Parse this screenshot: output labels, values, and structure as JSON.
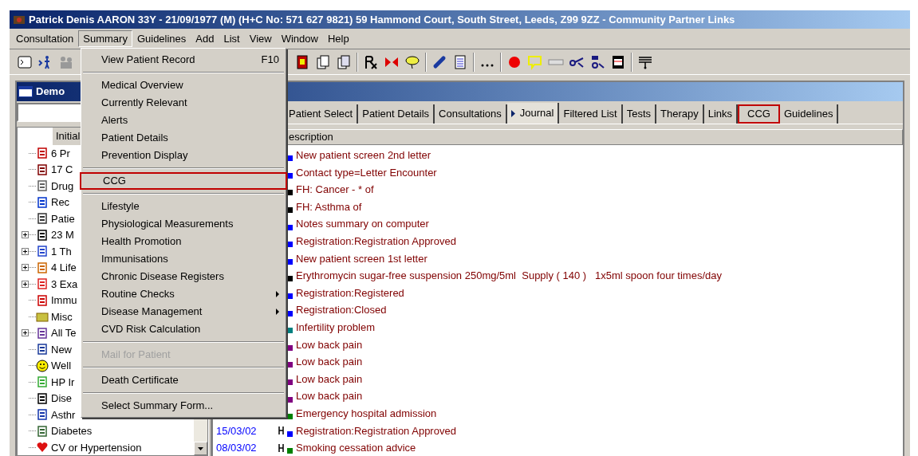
{
  "window": {
    "title": "Patrick Denis AARON 33Y - 21/09/1977 (M) (H+C No: 571 627 9821)  59 Hammond Court, South Street, Leeds, Z99 9ZZ - Community Partner Links"
  },
  "menu_bar": [
    {
      "label": "Consultation",
      "selected": false
    },
    {
      "label": "Summary",
      "selected": true
    },
    {
      "label": "Guidelines",
      "selected": false
    },
    {
      "label": "Add",
      "selected": false
    },
    {
      "label": "List",
      "selected": false
    },
    {
      "label": "View",
      "selected": false
    },
    {
      "label": "Window",
      "selected": false
    },
    {
      "label": "Help",
      "selected": false
    }
  ],
  "summary_menu": [
    {
      "kind": "item",
      "label": "View Patient Record",
      "shortcut": "F10",
      "submenu": false,
      "disabled": false,
      "highlighted": false
    },
    {
      "kind": "separator"
    },
    {
      "kind": "item",
      "label": "Medical Overview",
      "submenu": false,
      "disabled": false,
      "highlighted": false
    },
    {
      "kind": "item",
      "label": "Currently Relevant",
      "submenu": false,
      "disabled": false,
      "highlighted": false
    },
    {
      "kind": "item",
      "label": "Alerts",
      "submenu": false,
      "disabled": false,
      "highlighted": false
    },
    {
      "kind": "item",
      "label": "Patient Details",
      "submenu": false,
      "disabled": false,
      "highlighted": false
    },
    {
      "kind": "item",
      "label": "Prevention Display",
      "submenu": false,
      "disabled": false,
      "highlighted": false
    },
    {
      "kind": "separator"
    },
    {
      "kind": "item",
      "label": "CCG",
      "submenu": false,
      "disabled": false,
      "highlighted": true
    },
    {
      "kind": "separator"
    },
    {
      "kind": "item",
      "label": "Lifestyle",
      "submenu": false,
      "disabled": false,
      "highlighted": false
    },
    {
      "kind": "item",
      "label": "Physiological Measurements",
      "submenu": false,
      "disabled": false,
      "highlighted": false
    },
    {
      "kind": "item",
      "label": "Health Promotion",
      "submenu": false,
      "disabled": false,
      "highlighted": false
    },
    {
      "kind": "item",
      "label": "Immunisations",
      "submenu": false,
      "disabled": false,
      "highlighted": false
    },
    {
      "kind": "item",
      "label": "Chronic Disease Registers",
      "submenu": false,
      "disabled": false,
      "highlighted": false
    },
    {
      "kind": "item",
      "label": "Routine Checks",
      "submenu": true,
      "disabled": false,
      "highlighted": false
    },
    {
      "kind": "item",
      "label": "Disease Management",
      "submenu": true,
      "disabled": false,
      "highlighted": false
    },
    {
      "kind": "item",
      "label": "CVD Risk Calculation",
      "submenu": false,
      "disabled": false,
      "highlighted": false
    },
    {
      "kind": "separator"
    },
    {
      "kind": "item",
      "label": "Mail for Patient",
      "submenu": false,
      "disabled": true,
      "highlighted": false
    },
    {
      "kind": "separator"
    },
    {
      "kind": "item",
      "label": "Death Certificate",
      "submenu": false,
      "disabled": false,
      "highlighted": false
    },
    {
      "kind": "separator"
    },
    {
      "kind": "item",
      "label": "Select Summary Form...",
      "submenu": false,
      "disabled": false,
      "highlighted": false
    }
  ],
  "child_window": {
    "title": "Demo"
  },
  "tree": {
    "header": "Initial",
    "items": [
      {
        "label": "6 Pr",
        "kind": "leaf"
      },
      {
        "label": "17 C",
        "kind": "leaf"
      },
      {
        "label": "Drug",
        "kind": "leaf"
      },
      {
        "label": "Rec",
        "kind": "leaf"
      },
      {
        "label": "Patie",
        "kind": "leaf"
      },
      {
        "label": "23 M",
        "kind": "folder"
      },
      {
        "label": "1 Th",
        "kind": "folder"
      },
      {
        "label": "4 Life",
        "kind": "folder"
      },
      {
        "label": "3 Exa",
        "kind": "folder"
      },
      {
        "label": "Immu",
        "kind": "leaf"
      },
      {
        "label": "Misc",
        "kind": "leaf"
      },
      {
        "label": "All Te",
        "kind": "folder"
      },
      {
        "label": "New",
        "kind": "leaf"
      },
      {
        "label": "Well",
        "kind": "leaf"
      },
      {
        "label": "HP Ir",
        "kind": "leaf"
      },
      {
        "label": "Dise",
        "kind": "leaf"
      },
      {
        "label": "Asthr",
        "kind": "leaf"
      },
      {
        "label": "Diabetes",
        "kind": "leaf"
      },
      {
        "label": "CV or Hypertension",
        "kind": "leaf"
      }
    ]
  },
  "tabs": [
    {
      "label": "Patient Select",
      "selected": false,
      "highlighted": false
    },
    {
      "label": "Patient Details",
      "selected": false,
      "highlighted": false
    },
    {
      "label": "Consultations",
      "selected": false,
      "highlighted": false
    },
    {
      "label": "Journal",
      "selected": true,
      "highlighted": false
    },
    {
      "label": "Filtered List",
      "selected": false,
      "highlighted": false
    },
    {
      "label": "Tests",
      "selected": false,
      "highlighted": false
    },
    {
      "label": "Therapy",
      "selected": false,
      "highlighted": false
    },
    {
      "label": "Links",
      "selected": false,
      "highlighted": false
    },
    {
      "label": "CCG",
      "selected": false,
      "highlighted": true
    },
    {
      "label": "Guidelines",
      "selected": false,
      "highlighted": false
    }
  ],
  "journal": {
    "column_header": "escription",
    "rows": [
      {
        "description": "New patient screen 2nd letter",
        "color": "#0000ff"
      },
      {
        "description": "Contact type=Letter Encounter",
        "color": "#0000ff"
      },
      {
        "description": "FH: Cancer - * of",
        "color": "#000000"
      },
      {
        "description": "FH: Asthma of",
        "color": "#000000"
      },
      {
        "description": "Notes summary on computer",
        "color": "#0000ff"
      },
      {
        "description": "Registration:Registration Approved",
        "color": "#0000ff"
      },
      {
        "description": "New patient screen 1st letter",
        "color": "#0000ff"
      },
      {
        "description": "Erythromycin sugar-free suspension 250mg/5ml  Supply ( 140 )   1x5ml spoon four times/day",
        "color": "#000000"
      },
      {
        "description": "Registration:Registered",
        "color": "#0000ff"
      },
      {
        "description": "Registration:Closed",
        "color": "#0000ff"
      },
      {
        "description": "Infertility problem",
        "color": "#008080"
      },
      {
        "description": "Low back pain",
        "color": "#800080"
      },
      {
        "description": "Low back pain",
        "color": "#800080"
      },
      {
        "description": "Low back pain",
        "color": "#800080"
      },
      {
        "description": "Low back pain",
        "color": "#800080"
      },
      {
        "description": "Emergency hospital admission",
        "color": "#008000"
      },
      {
        "date": "15/03/02",
        "description": "Registration:Registration Approved",
        "color": "#0000ff"
      },
      {
        "date": "08/03/02",
        "description": "Smoking cessation advice",
        "color": "#008000"
      }
    ]
  }
}
